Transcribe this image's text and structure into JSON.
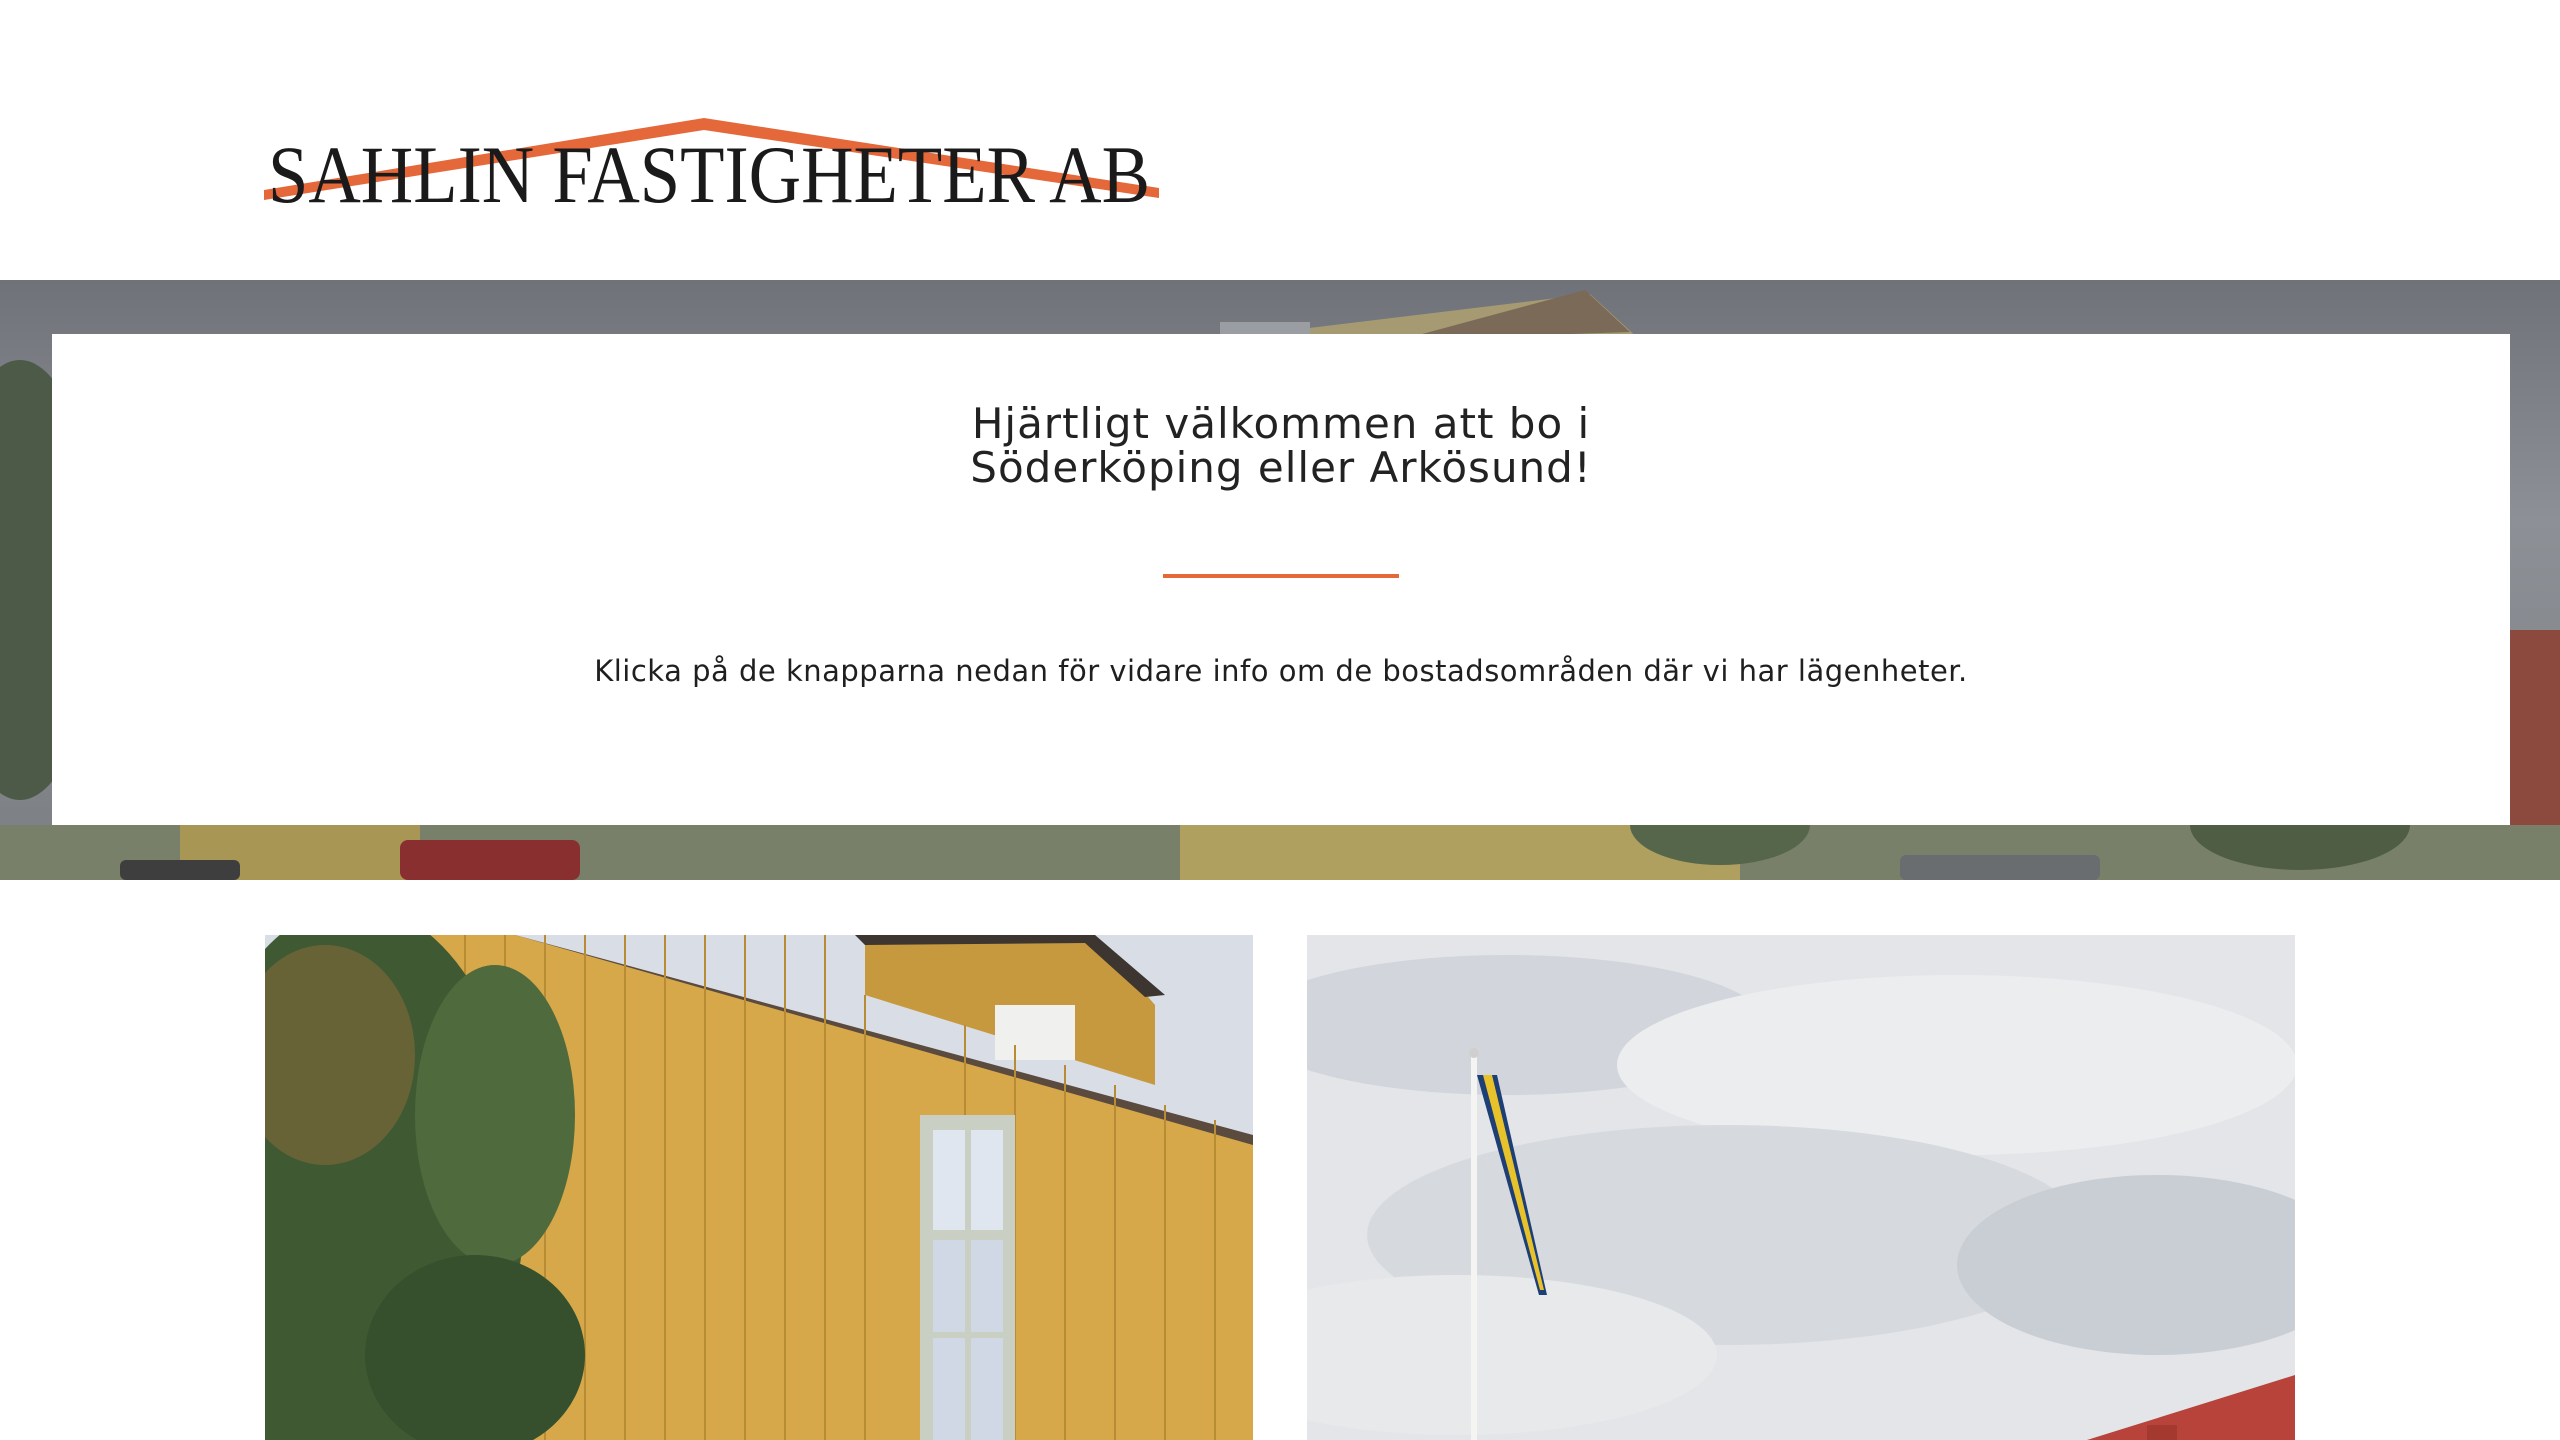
{
  "header": {
    "logo_text": "Sahlin Fastigheter AB",
    "logo_roof_color": "#e4683a"
  },
  "hero": {
    "title_line1": "Hjärtligt välkommen att bo i",
    "title_line2": "Söderköping eller Arkösund!",
    "text": "Klicka på de knapparna nedan för vidare info om de bostadsområden där vi har lägenheter.",
    "accent_color": "#e4683a"
  },
  "areas": [
    {
      "image": "yellow-house-photo"
    },
    {
      "image": "flagpole-sky-photo"
    }
  ]
}
